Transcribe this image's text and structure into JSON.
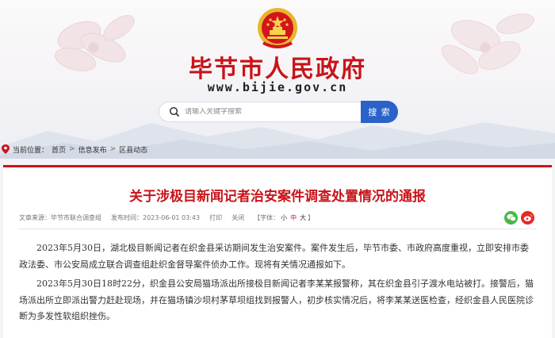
{
  "header": {
    "site_title": "毕节市人民政府",
    "site_url": "www.bijie.gov.cn",
    "search_placeholder": "请输入关键字搜索",
    "search_button": "搜 索",
    "emblem_icon": "national-emblem-icon",
    "colors": {
      "brand_red": "#c8141a",
      "search_blue": "#2a62c9"
    }
  },
  "breadcrumb": {
    "label": "当前位置：",
    "items": [
      "首页",
      "信息发布",
      "区县动态"
    ],
    "separator": ">"
  },
  "article": {
    "title": "关于涉极目新闻记者治安案件调查处置情况的通报",
    "meta": {
      "source_label": "文章来源：",
      "source": "毕节市联合调查组",
      "time_label": "发布时间：",
      "time": "2023-06-01 03:43",
      "print": "打印",
      "close": "关闭",
      "font_label": "【字体：",
      "font_small": "小",
      "font_medium": "中",
      "font_large": "大",
      "font_end": "】"
    },
    "share_icons": [
      "wechat-icon",
      "weibo-icon"
    ],
    "paragraphs": [
      "2023年5月30日，湖北极目新闻记者在织金县采访期间发生治安案件。案件发生后，毕节市委、市政府高度重视，立即安排市委政法委、市公安局成立联合调查组赴织金督导案件侦办工作。现将有关情况通报如下。",
      "2023年5月30日18时22分，织金县公安局猫场派出所接极目新闻记者李某某报警称，其在织金县引子渡水电站被打。接警后，猫场派出所立即派出警力赶赴现场，并在猫场镇沙坝村茅草坝组找到报警人，初步核实情况后，将李某某送医检查，经织金县人民医院诊断为多发性软组织挫伤。"
    ]
  }
}
